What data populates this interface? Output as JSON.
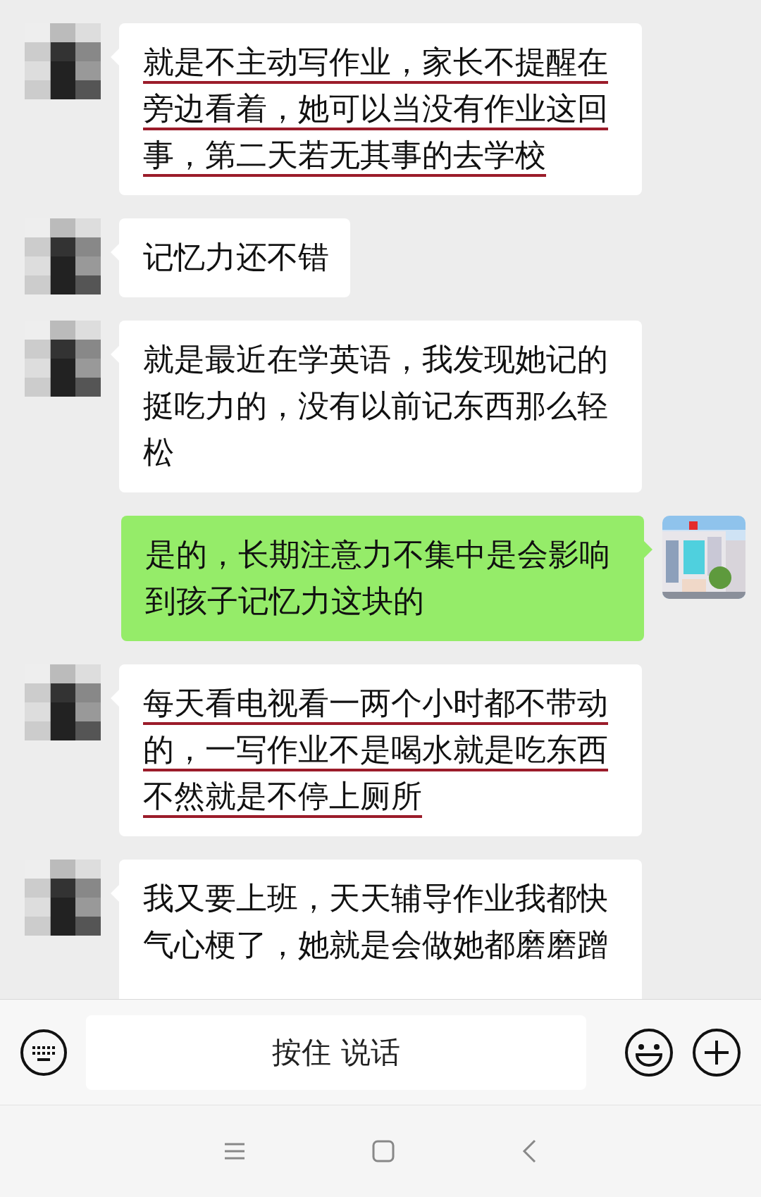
{
  "messages": [
    {
      "kind": "received",
      "text": "就是不主动写作业，家长不提醒在旁边看着，她可以当没有作业这回事，第二天若无其事的去学校",
      "underlined": true
    },
    {
      "kind": "received",
      "text": "记忆力还不错",
      "underlined": false
    },
    {
      "kind": "received",
      "text": "就是最近在学英语，我发现她记的挺吃力的，没有以前记东西那么轻松",
      "underlined": false
    },
    {
      "kind": "sent",
      "text": "是的，长期注意力不集中是会影响到孩子记忆力这块的",
      "underlined": false
    },
    {
      "kind": "received",
      "text": "每天看电视看一两个小时都不带动的，一写作业不是喝水就是吃东西不然就是不停上厕所",
      "underlined": true
    },
    {
      "kind": "received",
      "text": "我又要上班，天天辅导作业我都快气心梗了，她就是会做她都磨磨蹭",
      "underlined": false
    }
  ],
  "input_bar": {
    "hold_to_talk": "按住 说话"
  }
}
